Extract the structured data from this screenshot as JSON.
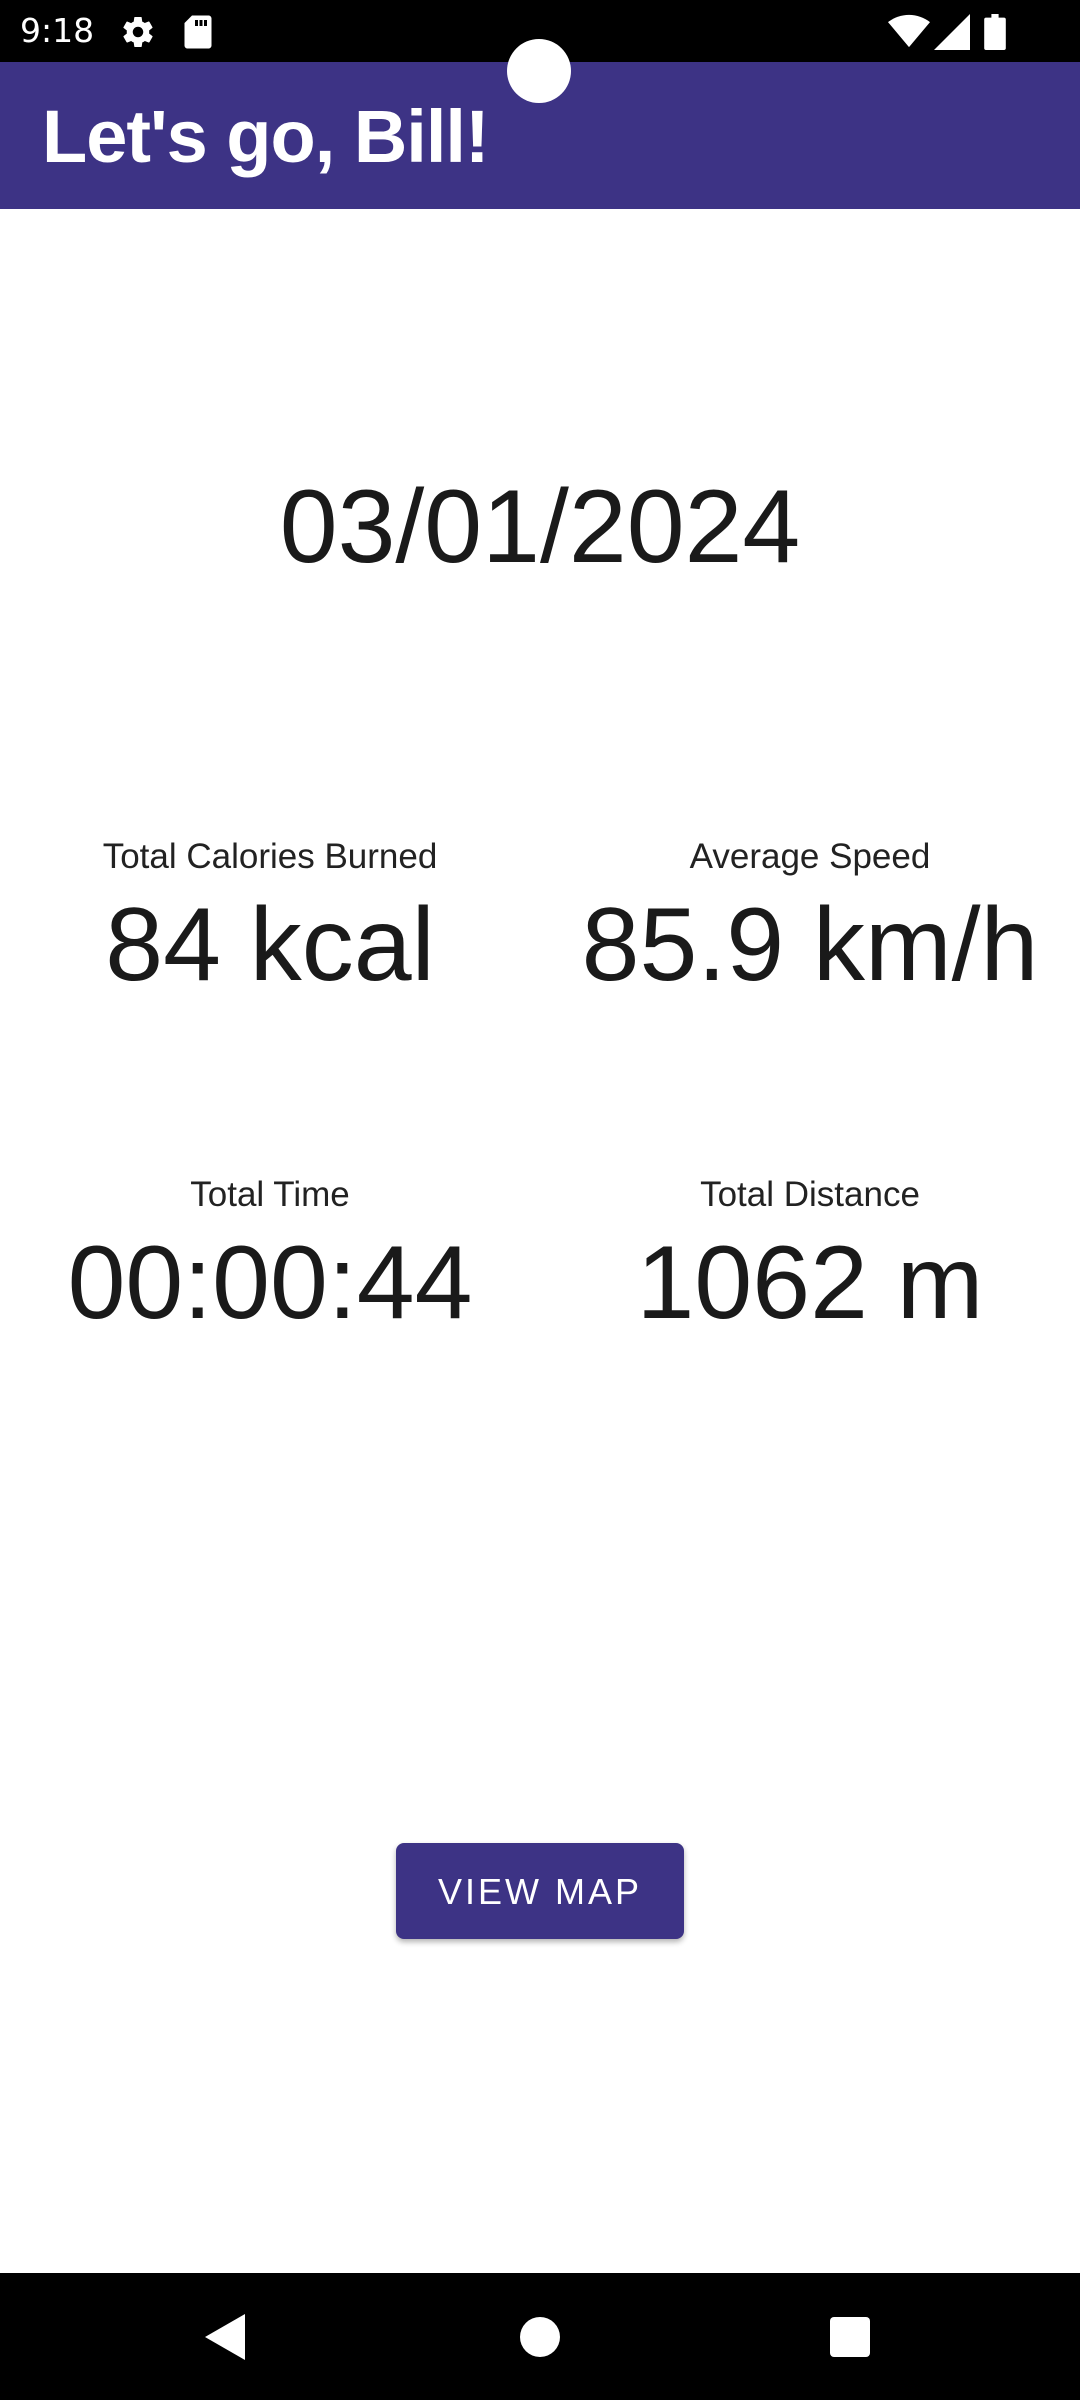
{
  "status_bar": {
    "time": "9:18",
    "icons": [
      "settings-icon",
      "sd-card-icon",
      "wifi-icon",
      "signal-icon",
      "battery-icon"
    ]
  },
  "app_bar": {
    "title": "Let's go, Bill!"
  },
  "main": {
    "date": "03/01/2024",
    "stats": {
      "calories": {
        "label": "Total Calories Burned",
        "value": "84 kcal"
      },
      "speed": {
        "label": "Average Speed",
        "value": "85.9 km/h"
      },
      "time": {
        "label": "Total Time",
        "value": "00:00:44"
      },
      "distance": {
        "label": "Total Distance",
        "value": "1062 m"
      }
    },
    "view_map_label": "VIEW MAP"
  },
  "nav_bar": {
    "buttons": [
      "back-icon",
      "home-icon",
      "recents-icon"
    ]
  },
  "colors": {
    "primary": "#3d3385",
    "background": "#ffffff",
    "text": "#1a1a1a"
  }
}
